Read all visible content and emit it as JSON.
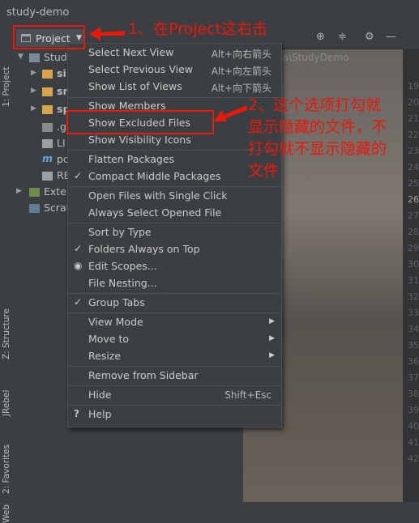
{
  "window": {
    "title": "study-demo"
  },
  "sidebar_left": {
    "tabs": [
      "1: Project",
      "Z: Structure",
      "JRebel",
      "2: Favorites",
      "Web"
    ]
  },
  "toolwindow": {
    "project_label": "Project",
    "path_fragment": "lea\\StudyDemo"
  },
  "tree": {
    "items": [
      {
        "label": "Study"
      },
      {
        "label": "si"
      },
      {
        "label": "sr"
      },
      {
        "label": "sp"
      },
      {
        "label": ".g"
      },
      {
        "label": "LI"
      },
      {
        "label": "pc"
      },
      {
        "label": "RE"
      },
      {
        "label": "Exter"
      },
      {
        "label": "Scrat"
      }
    ]
  },
  "gutter": {
    "line_numbers": [
      "19",
      "20",
      "21",
      "22",
      "23",
      "24",
      "25",
      "26",
      "27",
      "28",
      "29",
      "30",
      "31",
      "32",
      "33",
      "34",
      "35",
      "36",
      "37",
      "38",
      "39",
      "40",
      "41",
      "42"
    ]
  },
  "menu": {
    "items": [
      {
        "label": "Select Next View",
        "shortcut": "Alt+向右箭头"
      },
      {
        "label": "Select Previous View",
        "shortcut": "Alt+向左箭头"
      },
      {
        "label": "Show List of Views",
        "shortcut": "Alt+向下箭头"
      },
      {
        "label": "Show Members",
        "shortcut": ""
      },
      {
        "label": "Show Excluded Files",
        "shortcut": ""
      },
      {
        "label": "Show Visibility Icons",
        "shortcut": ""
      },
      {
        "label": "Flatten Packages",
        "shortcut": ""
      },
      {
        "label": "Compact Middle Packages",
        "shortcut": "",
        "mark": "✓"
      },
      {
        "label": "Open Files with Single Click",
        "shortcut": ""
      },
      {
        "label": "Always Select Opened File",
        "shortcut": ""
      },
      {
        "label": "Sort by Type",
        "shortcut": ""
      },
      {
        "label": "Folders Always on Top",
        "shortcut": "",
        "mark": "✓"
      },
      {
        "label": "Edit Scopes...",
        "shortcut": "",
        "mark": "◉"
      },
      {
        "label": "File Nesting...",
        "shortcut": ""
      },
      {
        "label": "Group Tabs",
        "shortcut": "",
        "mark": "✓"
      },
      {
        "label": "View Mode",
        "shortcut": ""
      },
      {
        "label": "Move to",
        "shortcut": ""
      },
      {
        "label": "Resize",
        "shortcut": ""
      },
      {
        "label": "Remove from Sidebar",
        "shortcut": ""
      },
      {
        "label": "Hide",
        "shortcut": "Shift+Esc"
      },
      {
        "label": "Help",
        "shortcut": "",
        "mark": "?"
      }
    ]
  },
  "annotations": {
    "note1": "1、在Project这右击",
    "note2_line1": "2、这个选项打勾就",
    "note2_line2": "显示隐藏的文件，不",
    "note2_line3": "打勾就不显示隐藏的",
    "note2_line4": "文件"
  },
  "colors": {
    "annotation_red": "#e8190c",
    "menu_bg": "#3c3f41"
  }
}
